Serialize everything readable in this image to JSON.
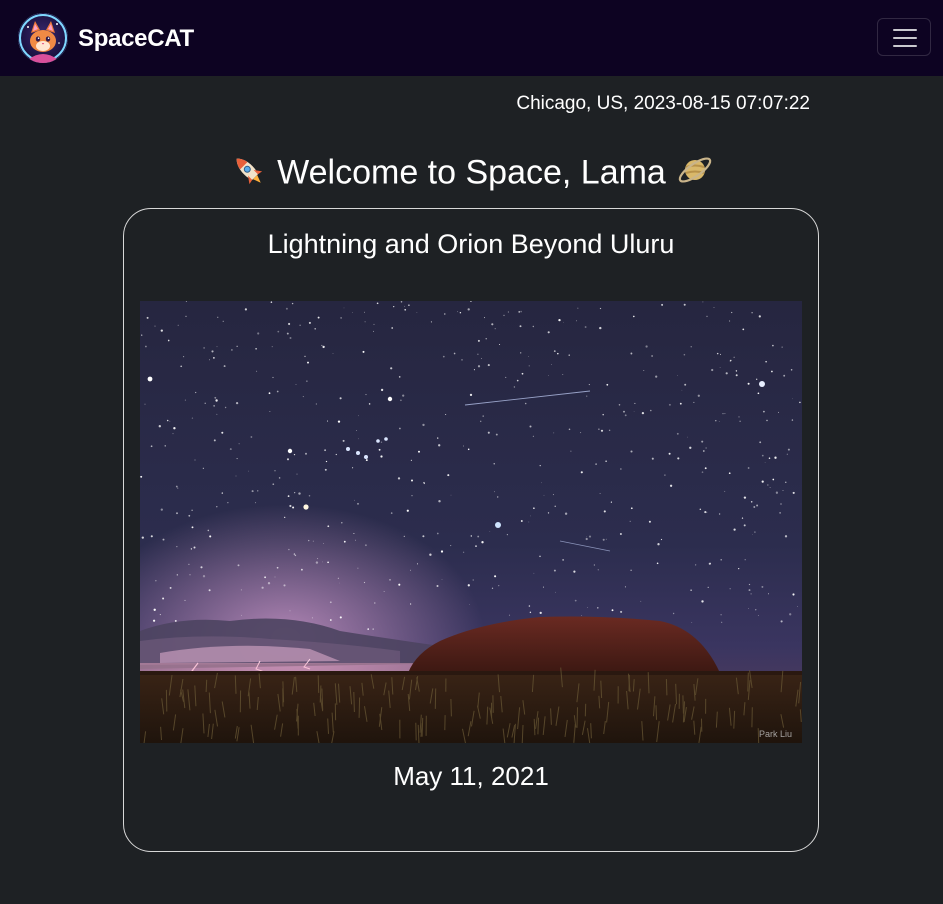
{
  "navbar": {
    "brand_name": "SpaceCAT",
    "logo_icon": "cat-astronaut-logo-icon",
    "menu_icon": "hamburger-menu-icon",
    "background_color": "#0d0322"
  },
  "header": {
    "location_time": "Chicago, US, 2023-08-15 07:07:22"
  },
  "welcome": {
    "text": "Welcome to Space, Lama",
    "left_icon": "rocket-icon",
    "right_icon": "ringed-planet-icon"
  },
  "apod": {
    "title": "Lightning and Orion Beyond Uluru",
    "image_alt": "night-sky-uluru-photo",
    "credit": "Park Liu",
    "date": "May 11, 2021"
  },
  "theme": {
    "page_background": "#1e2124",
    "card_border": "#d8d8d8",
    "text": "#ffffff"
  }
}
